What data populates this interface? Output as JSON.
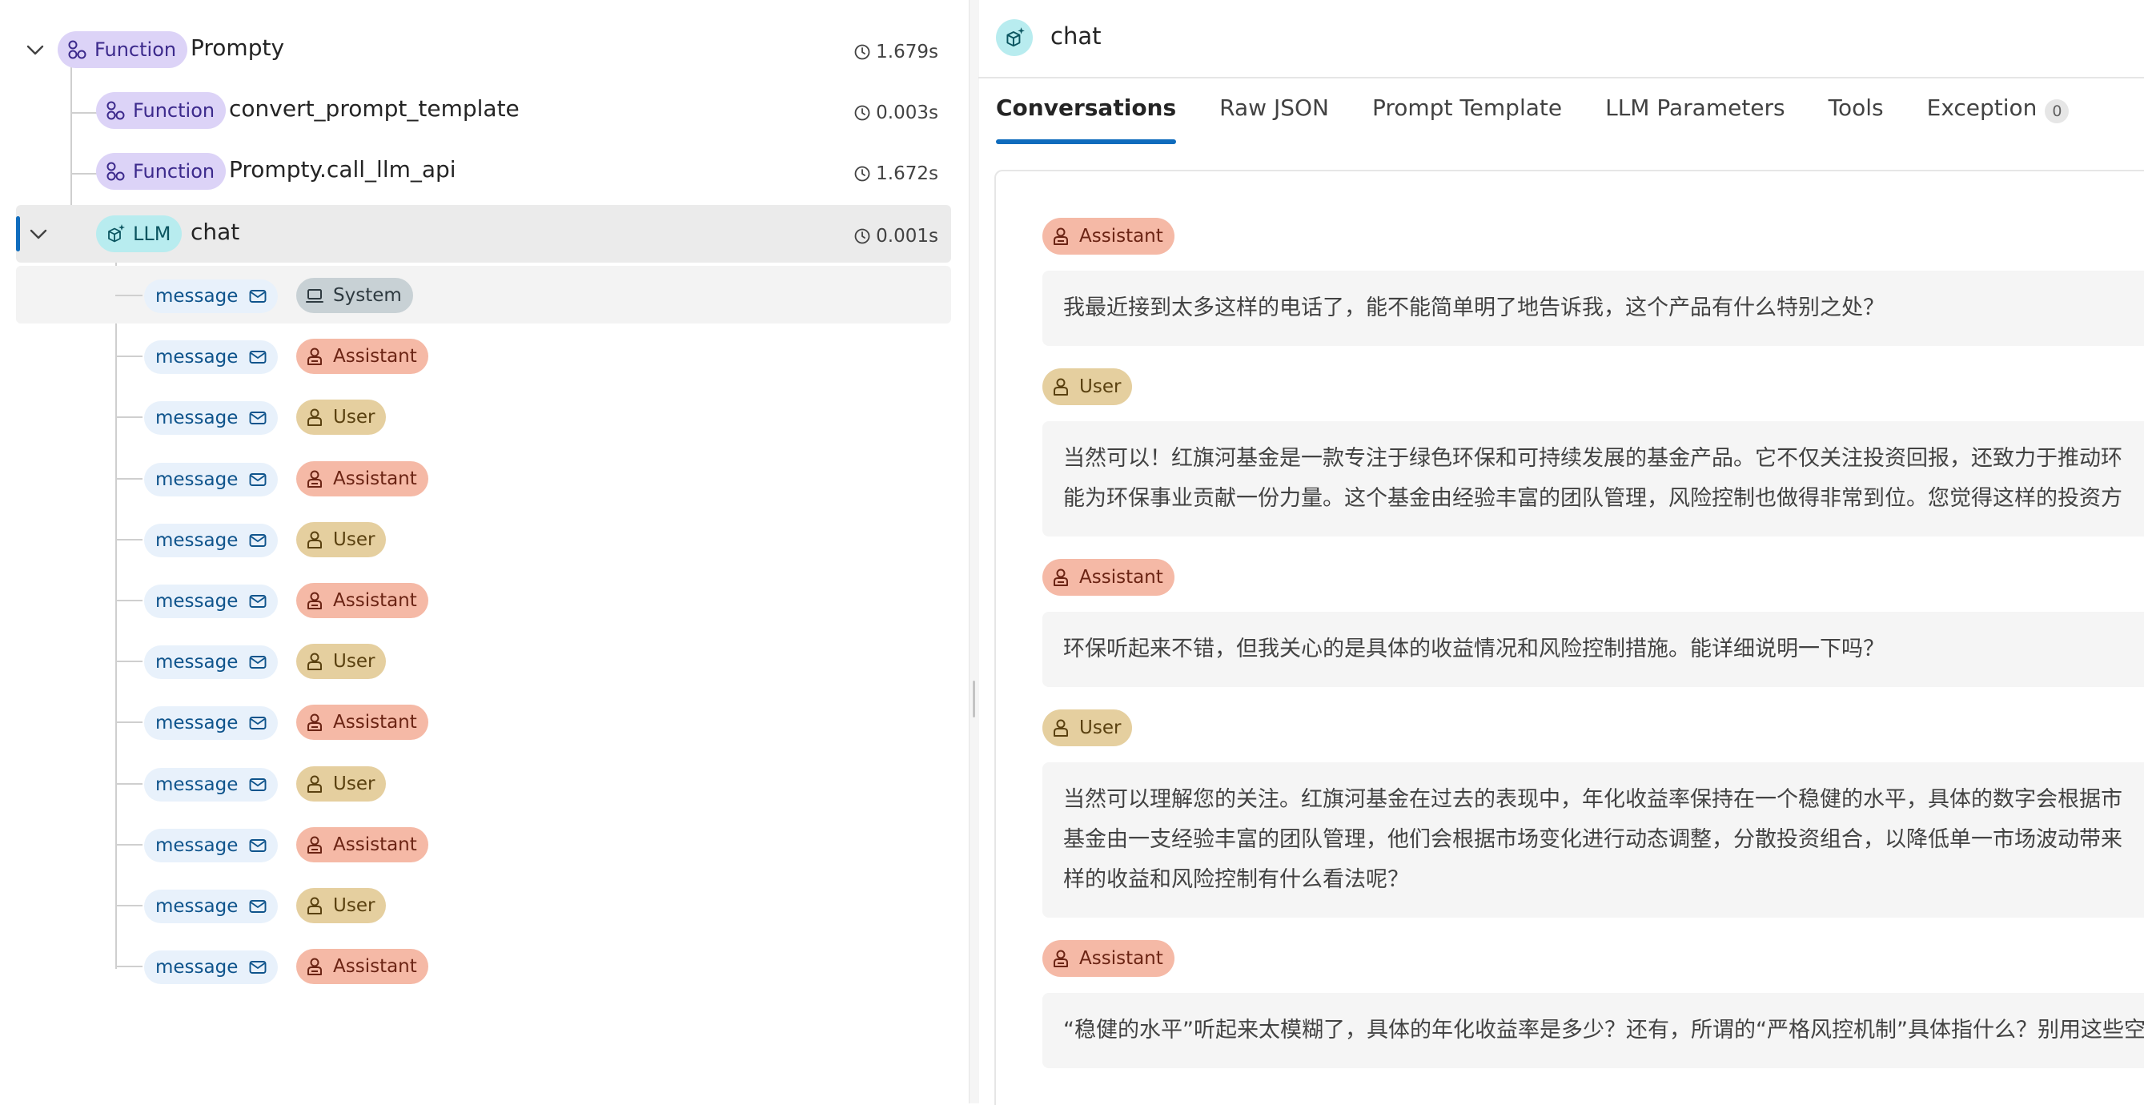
{
  "tree": {
    "nodes": [
      {
        "kind": "Function",
        "name": "Prompty",
        "duration": "1.679s"
      },
      {
        "kind": "Function",
        "name": "convert_prompt_template",
        "duration": "0.003s"
      },
      {
        "kind": "Function",
        "name": "Prompty.call_llm_api",
        "duration": "1.672s"
      },
      {
        "kind": "LLM",
        "name": "chat",
        "duration": "0.001s"
      }
    ],
    "messages": [
      {
        "label": "message",
        "role": "System"
      },
      {
        "label": "message",
        "role": "Assistant"
      },
      {
        "label": "message",
        "role": "User"
      },
      {
        "label": "message",
        "role": "Assistant"
      },
      {
        "label": "message",
        "role": "User"
      },
      {
        "label": "message",
        "role": "Assistant"
      },
      {
        "label": "message",
        "role": "User"
      },
      {
        "label": "message",
        "role": "Assistant"
      },
      {
        "label": "message",
        "role": "User"
      },
      {
        "label": "message",
        "role": "Assistant"
      },
      {
        "label": "message",
        "role": "User"
      },
      {
        "label": "message",
        "role": "Assistant"
      }
    ]
  },
  "detail": {
    "title": "chat",
    "tabs": [
      {
        "label": "Conversations"
      },
      {
        "label": "Raw JSON"
      },
      {
        "label": "Prompt Template"
      },
      {
        "label": "LLM Parameters"
      },
      {
        "label": "Tools"
      },
      {
        "label": "Exception",
        "count": "0"
      }
    ],
    "conversation": [
      {
        "role": "Assistant",
        "lines": [
          "我最近接到太多这样的电话了，能不能简单明了地告诉我，这个产品有什么特别之处？"
        ]
      },
      {
        "role": "User",
        "lines": [
          "当然可以！红旗河基金是一款专注于绿色环保和可持续发展的基金产品。它不仅关注投资回报，还致力于推动环",
          "能为环保事业贡献一份力量。这个基金由经验丰富的团队管理，风险控制也做得非常到位。您觉得这样的投资方"
        ]
      },
      {
        "role": "Assistant",
        "lines": [
          "环保听起来不错，但我关心的是具体的收益情况和风险控制措施。能详细说明一下吗？"
        ]
      },
      {
        "role": "User",
        "lines": [
          "当然可以理解您的关注。红旗河基金在过去的表现中，年化收益率保持在一个稳健的水平，具体的数字会根据市",
          "基金由一支经验丰富的团队管理，他们会根据市场变化进行动态调整，分散投资组合，以降低单一市场波动带来",
          "样的收益和风险控制有什么看法呢？"
        ]
      },
      {
        "role": "Assistant",
        "lines": [
          "“稳健的水平”听起来太模糊了，具体的年化收益率是多少？还有，所谓的“严格风控机制”具体指什么？别用这些空"
        ]
      }
    ]
  },
  "colors": {
    "accent": "#0f6cbd",
    "function": "#dcd3f7",
    "llm": "#b8ecef",
    "assistant": "#f5b9a6",
    "user": "#e5cf9f",
    "system": "#c8d1d5"
  }
}
